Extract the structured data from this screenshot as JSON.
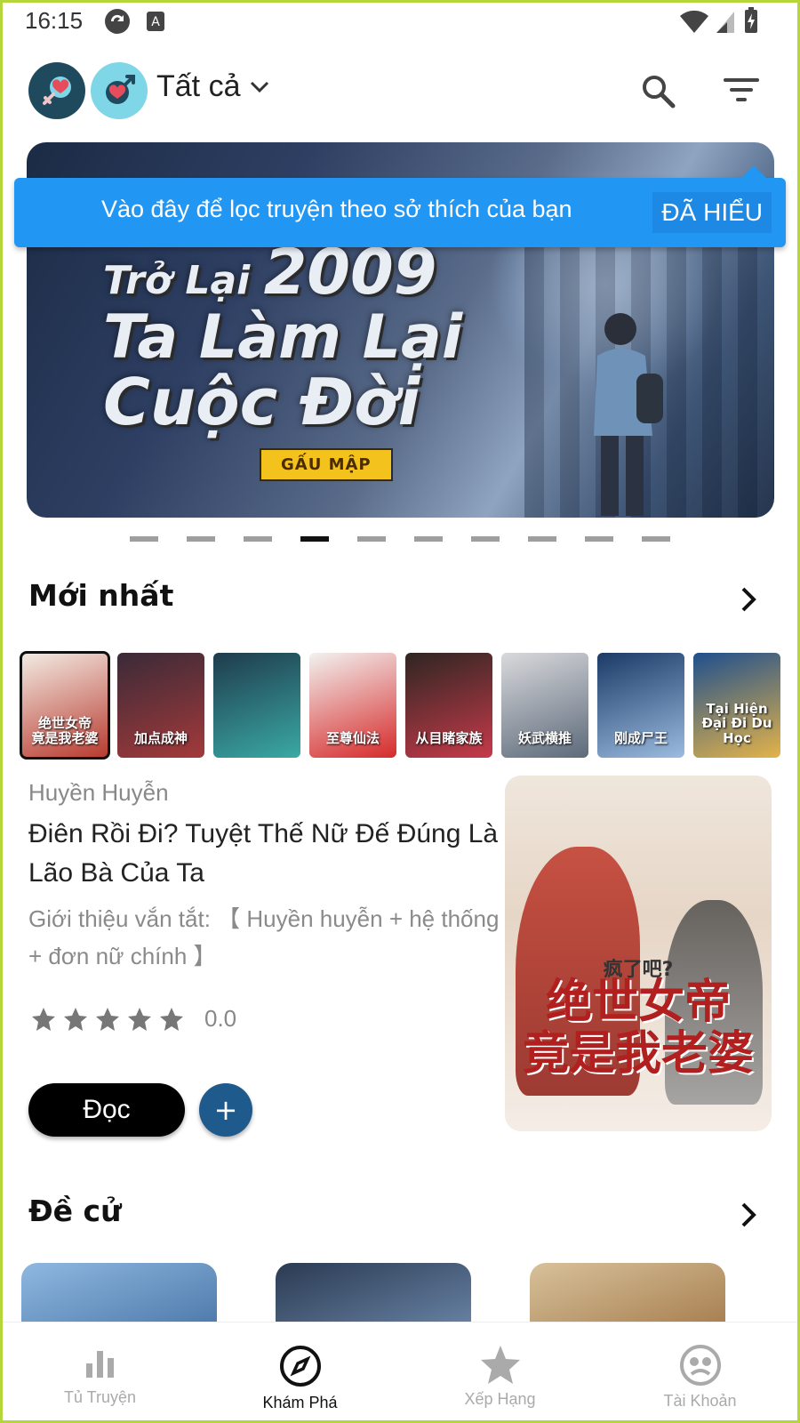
{
  "status_bar": {
    "time": "16:15"
  },
  "header": {
    "filter_label": "Tất cả"
  },
  "banner": {
    "title_line1_a": "Trở Lại",
    "title_line1_b": "2009",
    "title_line2": "Ta Làm Lại",
    "title_line3": "Cuộc Đời",
    "author_tag": "GẤU MẬP",
    "dot_count": 10,
    "active_dot": 4
  },
  "tooltip": {
    "text": "Vào đây để lọc truyện theo sở thích của bạn",
    "button": "ĐÃ HIỂU"
  },
  "newest": {
    "title": "Mới nhất",
    "thumbnails": [
      {
        "label": "绝世女帝\n竟是我老婆",
        "colors": [
          "#f3ece4",
          "#b83a2f"
        ]
      },
      {
        "label": "加点成神",
        "colors": [
          "#3a2a38",
          "#a33a3a"
        ]
      },
      {
        "label": "",
        "colors": [
          "#1f3b4d",
          "#3aa9a4"
        ]
      },
      {
        "label": "至尊仙法",
        "colors": [
          "#f2f2f0",
          "#d62a2a"
        ]
      },
      {
        "label": "从目睹家族",
        "colors": [
          "#2e2622",
          "#c63a4a"
        ]
      },
      {
        "label": "妖武横推",
        "colors": [
          "#d9d9dc",
          "#5c6a7a"
        ]
      },
      {
        "label": "刚成尸王",
        "colors": [
          "#1b3a66",
          "#9bbbe0"
        ]
      },
      {
        "label": "Tại Hiện Đại Đi Du Học",
        "colors": [
          "#1f4f8c",
          "#e3b34a"
        ]
      }
    ],
    "featured": {
      "genre": "Huyền Huyễn",
      "title": "Điên Rồi Đi? Tuyệt Thế Nữ Đế Đúng Là Lão Bà Của Ta",
      "description": "Giới thiệu vắn tắt: 【 Huyền huyễn + hệ thống + đơn nữ chính 】",
      "rating_text": "0.0",
      "stars": 5,
      "read_button": "Đọc",
      "add_button": "+",
      "cover_subtitle": "疯了吧?",
      "cover_title": "绝世女帝\n竟是我老婆"
    }
  },
  "recommended": {
    "title": "Đề cử",
    "items": [
      {
        "colors": [
          "#8fb8e0",
          "#4a76a8"
        ]
      },
      {
        "colors": [
          "#2b3a52",
          "#6a86a8"
        ]
      },
      {
        "colors": [
          "#d8c19a",
          "#a47b4c"
        ]
      }
    ]
  },
  "bottom_nav": {
    "items": [
      {
        "label": "Tủ Truyện",
        "icon": "bar-chart-icon",
        "active": false
      },
      {
        "label": "Khám Phá",
        "icon": "compass-icon",
        "active": true
      },
      {
        "label": "Xếp Hạng",
        "icon": "star-icon",
        "active": false
      },
      {
        "label": "Tài Khoản",
        "icon": "account-icon",
        "active": false
      }
    ]
  },
  "colors": {
    "tooltip_bg": "#2196f3",
    "add_button_bg": "#1e5a8c",
    "frame": "#b5d63a"
  }
}
